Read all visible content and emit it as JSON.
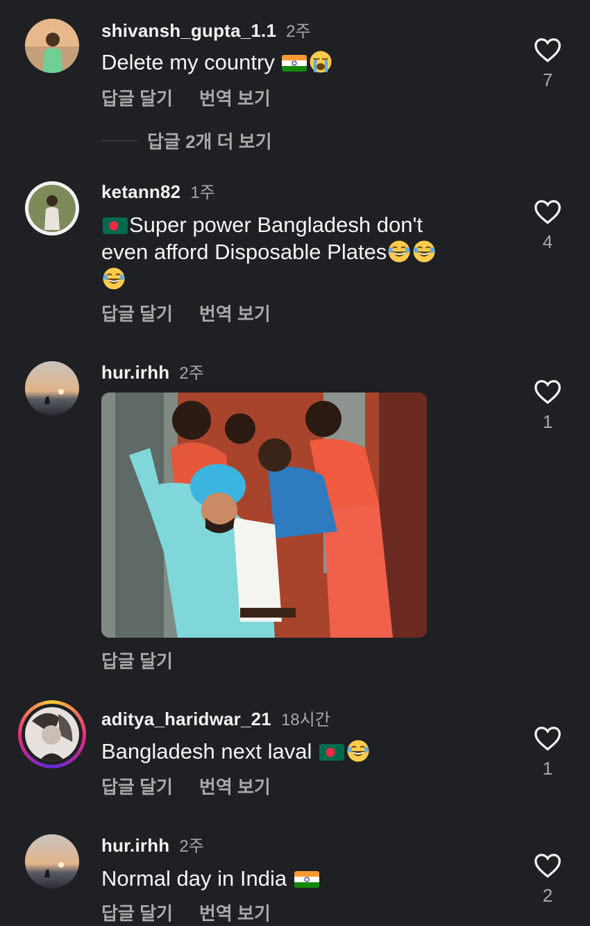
{
  "labels": {
    "reply": "답글 달기",
    "translate": "번역 보기"
  },
  "comments": [
    {
      "username": "shivansh_gupta_1.1",
      "time": "2주",
      "text": "Delete my country",
      "emoji": [
        "flag-india",
        "crying-face"
      ],
      "likes": "7",
      "more_replies": "답글 2개 더 보기"
    },
    {
      "username": "ketann82",
      "time": "1주",
      "text_line1": "Super power Bangladesh don't",
      "text_line2": "even afford Disposable Plates",
      "emoji": [
        "flag-bangladesh",
        "laughing-face",
        "laughing-face",
        "laughing-face"
      ],
      "likes": "4"
    },
    {
      "username": "hur.irhh",
      "time": "2주",
      "attachment": "gif",
      "likes": "1"
    },
    {
      "username": "aditya_haridwar_21",
      "time": "18시간",
      "text": "Bangladesh next laval",
      "emoji": [
        "flag-bangladesh",
        "laughing-face"
      ],
      "likes": "1"
    },
    {
      "username": "hur.irhh",
      "time": "2주",
      "text": "Normal day in India",
      "emoji": [
        "flag-india"
      ],
      "likes": "2"
    }
  ],
  "colors": {
    "background": "#1f2024",
    "primary_text": "#f5f5f5",
    "secondary_text": "#a8a8a8"
  }
}
